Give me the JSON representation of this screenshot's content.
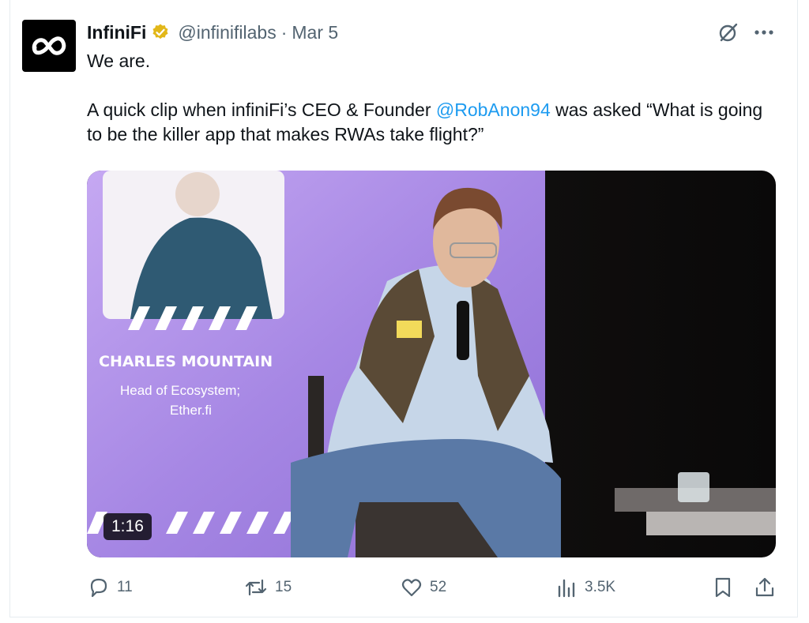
{
  "tweet": {
    "author_name": "InfiniFi",
    "handle": "@infinifilabs",
    "separator": "·",
    "date": "Mar 5",
    "text_line1": "We are.",
    "text_line2_pre": "A quick clip when infiniFi’s CEO & Founder ",
    "mention": "@RobAnon94",
    "text_line2_post": " was asked “What is going to be the killer app that makes RWAs take flight?”"
  },
  "video": {
    "duration": "1:16",
    "overlay_name": "CHARLES MOUNTAIN",
    "overlay_title": "Head of Ecosystem;",
    "overlay_org": "Ether.fi"
  },
  "actions": {
    "replies": "11",
    "reposts": "15",
    "likes": "52",
    "views": "3.5K"
  },
  "colors": {
    "accent": "#1d9bf0",
    "muted": "#536471",
    "verified": "#e2b719",
    "slide_purple": "#a88be6"
  },
  "icons": [
    "infinity-logo-icon",
    "verified-badge-icon",
    "grok-icon",
    "more-icon",
    "reply-icon",
    "repost-icon",
    "like-icon",
    "views-icon",
    "bookmark-icon",
    "share-icon"
  ]
}
